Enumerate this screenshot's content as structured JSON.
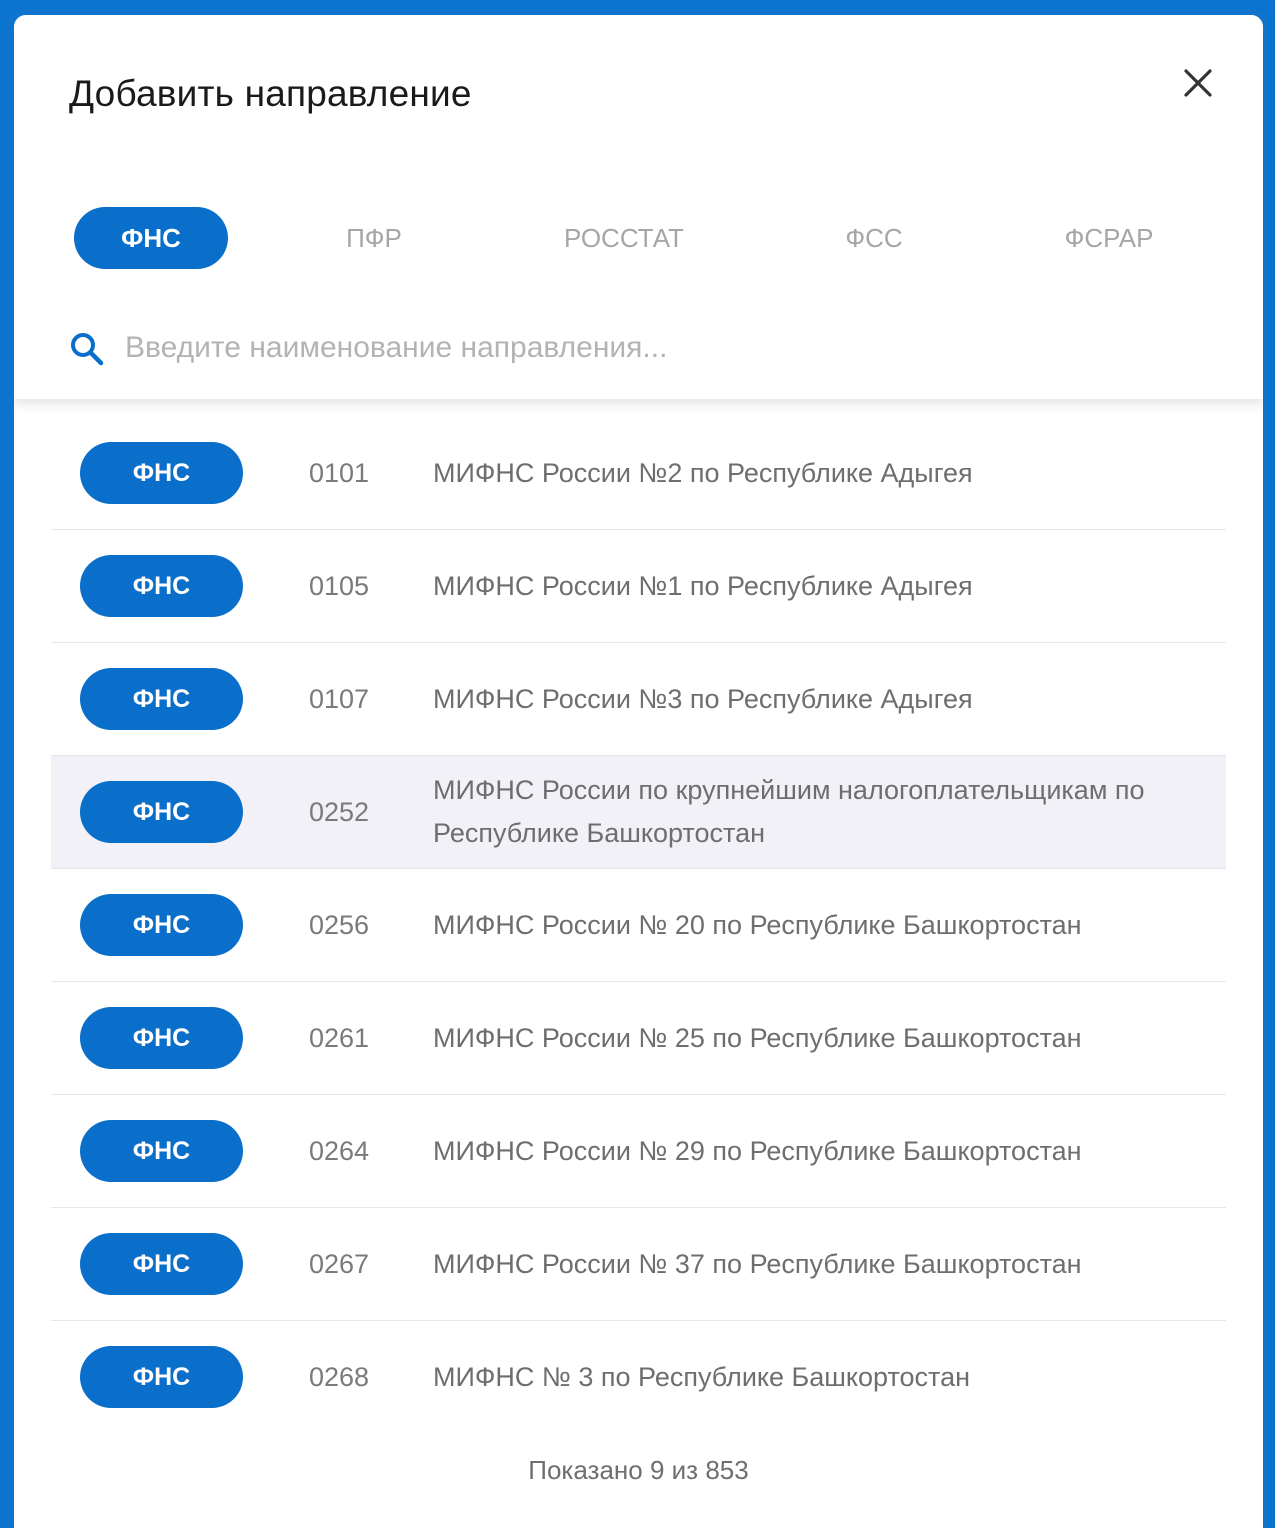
{
  "modal": {
    "title": "Добавить направление",
    "close_label": "close"
  },
  "tabs": [
    {
      "label": "ФНС",
      "active": true
    },
    {
      "label": "ПФР",
      "active": false
    },
    {
      "label": "РОССТАТ",
      "active": false
    },
    {
      "label": "ФСС",
      "active": false
    },
    {
      "label": "ФСРАР",
      "active": false
    }
  ],
  "search": {
    "placeholder": "Введите наименование направления...",
    "value": ""
  },
  "rows": [
    {
      "badge": "ФНС",
      "code": "0101",
      "name": "МИФНС России №2 по Республике Адыгея",
      "highlight": false
    },
    {
      "badge": "ФНС",
      "code": "0105",
      "name": "МИФНС России №1 по Республике Адыгея",
      "highlight": false
    },
    {
      "badge": "ФНС",
      "code": "0107",
      "name": "МИФНС России №3 по Республике Адыгея",
      "highlight": false
    },
    {
      "badge": "ФНС",
      "code": "0252",
      "name": "МИФНС России по крупнейшим налогоплательщикам по Республике Башкортостан",
      "highlight": true
    },
    {
      "badge": "ФНС",
      "code": "0256",
      "name": "МИФНС России № 20 по Республике Башкортостан",
      "highlight": false
    },
    {
      "badge": "ФНС",
      "code": "0261",
      "name": "МИФНС России № 25 по Республике Башкортостан",
      "highlight": false
    },
    {
      "badge": "ФНС",
      "code": "0264",
      "name": "МИФНС России № 29 по Республике Башкортостан",
      "highlight": false
    },
    {
      "badge": "ФНС",
      "code": "0267",
      "name": "МИФНС России № 37 по Республике Башкортостан",
      "highlight": false
    },
    {
      "badge": "ФНС",
      "code": "0268",
      "name": "МИФНС № 3 по Республике Башкортостан",
      "highlight": false
    }
  ],
  "footer": {
    "text": "Показано 9 из 853"
  },
  "colors": {
    "accent": "#0a6fcb",
    "frame": "#1073cc",
    "row_highlight": "#f2f1f8"
  }
}
